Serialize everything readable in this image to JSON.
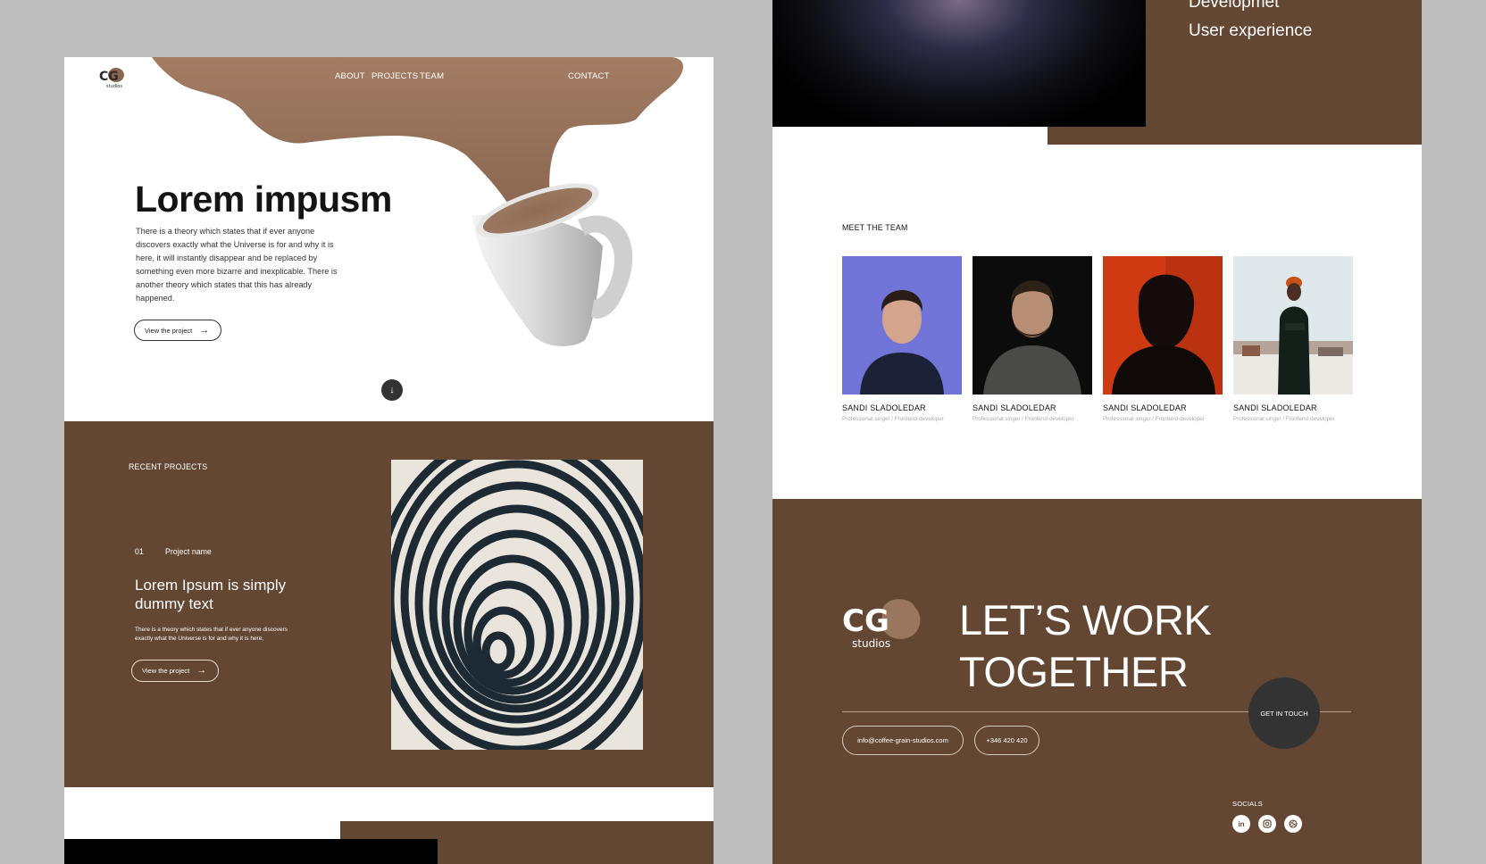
{
  "left_page": {
    "nav": {
      "about": "ABOUT",
      "projects": "PROJECTS",
      "team": "TEAM",
      "contact": "CONTACT"
    },
    "logo": {
      "letters": "CG",
      "sub": "studios"
    },
    "hero": {
      "title": "Lorem impusm",
      "text": "There is a theory which states that if ever anyone discovers exactly what the Universe is for and why it is here, it will instantly disappear and be replaced by something even more bizarre and inexplicable. There is another theory which states that this has already happened.",
      "button_label": "View the project",
      "scroll_icon": "arrow-down-icon"
    },
    "projects": {
      "label": "RECENT PROJECTS",
      "number": "01",
      "name": "Project name",
      "title": "Lorem Ipsum is simply dummy text",
      "description": "There is a theory which states that if ever anyone discovers exactly what the Universe is for and why it is here,",
      "button_label": "View the project"
    }
  },
  "right_page": {
    "services": {
      "item1": "Developmet",
      "item2": "User experience"
    },
    "team": {
      "label": "MEET THE TEAM",
      "members": [
        {
          "name": "SANDI SLADOLEDAR",
          "role": "Professional singer / Frontend-developer"
        },
        {
          "name": "SANDI SLADOLEDAR",
          "role": "Professional singer / Frontend-developer"
        },
        {
          "name": "SANDI SLADOLEDAR",
          "role": "Professional singer / Frontend-developer"
        },
        {
          "name": "SANDI SLADOLEDAR",
          "role": "Professional singer / Frontend-developer"
        }
      ]
    },
    "footer": {
      "logo": {
        "letters": "CG",
        "sub": "studios"
      },
      "cta_line1": "LET’S WORK",
      "cta_line2": "TOGETHER",
      "get_in_touch": "GET IN TOUCH",
      "email": "info@coffee-grain-studios.com",
      "phone": "+346 420 420",
      "socials_label": "SOCIALS",
      "socials": [
        "linkedin-icon",
        "instagram-icon",
        "dribbble-icon"
      ]
    }
  },
  "colors": {
    "brown": "#634733",
    "hero_blob": "#9a765e",
    "background": "#bebebe",
    "dark_button": "#333333"
  }
}
